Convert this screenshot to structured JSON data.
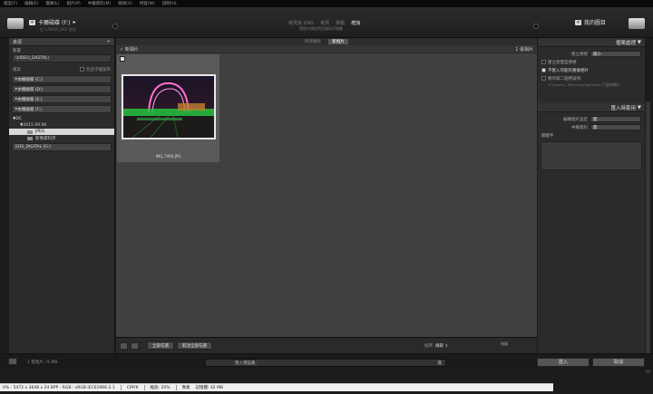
{
  "menu": [
    "檔案(F)",
    "編輯(E)",
    "圖庫(L)",
    "相片(P)",
    "中繼資料(M)",
    "檢視(V)",
    "視窗(W)",
    "說明(H)"
  ],
  "source": {
    "badge": "中",
    "title": "卡爾磁碟 (F:)",
    "chevron": "▸",
    "sub": "從 CANON_DIGI 拷貝"
  },
  "modes": [
    {
      "label": "拷貝為 DNG",
      "active": false
    },
    {
      "label": "拷貝",
      "active": false
    },
    {
      "label": "移動",
      "active": false
    },
    {
      "label": "增加",
      "active": true
    }
  ],
  "mode_desc": "將相片增加到目錄而不移動",
  "destination": {
    "badge": "中",
    "title": "我的圖目"
  },
  "left": {
    "header": "來源",
    "header_plus": "+",
    "devices_label": "裝置",
    "device_value": "\\VIDEO_DIGITAL\\",
    "files_label": "檔案",
    "include_sub": "包含子檔案夾",
    "volumes": [
      "本機磁碟 (C:)",
      "本機磁碟 (D:)",
      "本機磁碟 (E:)",
      "本機磁碟 (F:)"
    ],
    "tree": [
      {
        "label": "DC",
        "depth": 0,
        "arrow": "▼"
      },
      {
        "label": "2015.09.06",
        "depth": 1,
        "arrow": "▼"
      },
      {
        "label": "JPEG",
        "depth": 2,
        "selected": true
      },
      {
        "label": "影像資料夾",
        "depth": 2
      }
    ],
    "extra_volume": "EOS_DIGITAL (G:)"
  },
  "tabs": [
    {
      "label": "所有相片",
      "on": false
    },
    {
      "label": "新相片",
      "on": true
    }
  ],
  "group": {
    "label": "新相片",
    "count": "1 張相片"
  },
  "photo": {
    "filename": "IMG_7464.JPG"
  },
  "footer": {
    "check_all": "全部勾選",
    "uncheck_all": "取消全部勾選",
    "sort_label": "排序:",
    "sort_value": "擷取",
    "thumb_label": "縮圖"
  },
  "right": {
    "file_handling_header": "檔案處理",
    "build_preview_label": "建立預視",
    "build_preview_value": "最小",
    "smart_preview": "建立智慧型預視",
    "no_duplicates": "不匯入可能的重複相片",
    "second_copy": "製作第二個拷貝到:",
    "second_copy_path": "C:\\Users\\...\\Pictures\\Lightroom\\下載的備份",
    "apply_header": "匯入時套用",
    "develop_label": "編輯相片設定",
    "develop_value": "無",
    "metadata_label": "中繼資料",
    "metadata_value": "無",
    "keywords_label": "關鍵字"
  },
  "bottom": {
    "info": "1 張相片 / 6 MB",
    "preset": "匯入預設集:",
    "preset_value": "無",
    "import_button": "匯入",
    "cancel_button": "取消"
  },
  "status": {
    "dims": "0% - 5472 x 3648 x 24 BPP - RGB - sRGB IEC61966-2.1",
    "mode": "CMYK",
    "zoom": "縮放: 20%",
    "pixel": "像素",
    "memory": "記憶體: 42 MB"
  }
}
